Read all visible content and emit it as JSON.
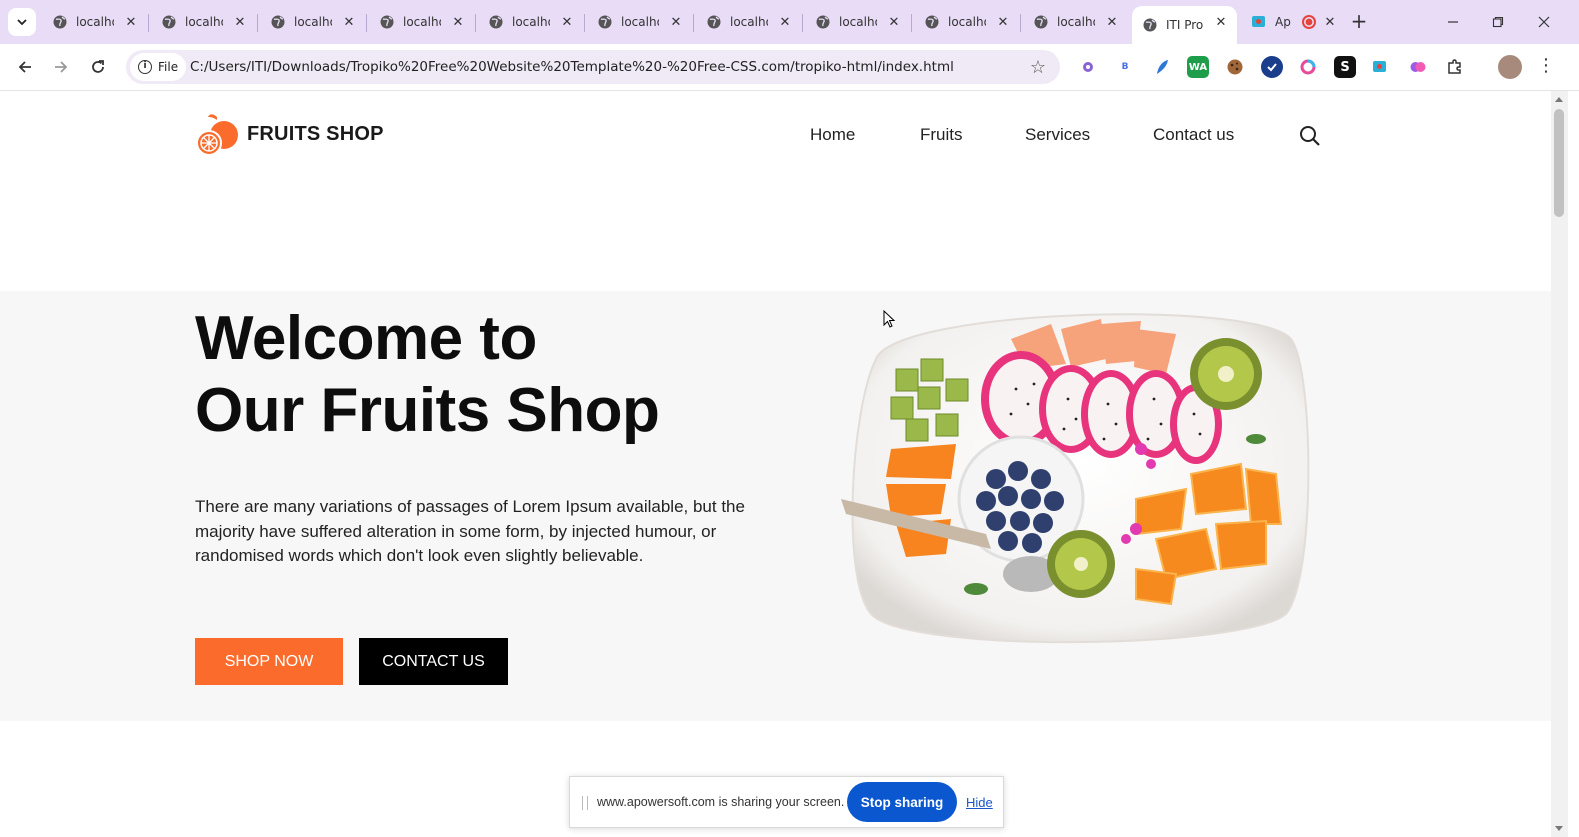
{
  "browser": {
    "tabs": [
      {
        "label": "localhost"
      },
      {
        "label": "localhost"
      },
      {
        "label": "localhost"
      },
      {
        "label": "localhost"
      },
      {
        "label": "localhost"
      },
      {
        "label": "localhost"
      },
      {
        "label": "localhost"
      },
      {
        "label": "localhost"
      },
      {
        "label": "localhost"
      },
      {
        "label": "localhost"
      },
      {
        "label": "ITI Pro"
      },
      {
        "label": "Ap"
      }
    ],
    "site_chip": "File",
    "url": "C:/Users/ITI/Downloads/Tropiko%20Free%20Website%20Template%20-%20Free-CSS.com/tropiko-html/index.html"
  },
  "site": {
    "logo_text": "FRUITS SHOP",
    "nav": {
      "home": "Home",
      "fruits": "Fruits",
      "services": "Services",
      "contact": "Contact us"
    },
    "hero": {
      "title_line1": "Welcome to",
      "title_line2": "Our Fruits Shop",
      "text": "There are many variations of passages of Lorem Ipsum available, but the majority have suffered alteration in some form, by injected humour, or randomised words which don't look even slightly believable.",
      "shop_button": "SHOP NOW",
      "contact_button": "CONTACT US"
    },
    "colors": {
      "accent": "#fb6c2c",
      "dark": "#000000"
    }
  },
  "share_bar": {
    "message": "www.apowersoft.com is sharing your screen.",
    "stop_label": "Stop sharing",
    "hide_label": "Hide"
  }
}
